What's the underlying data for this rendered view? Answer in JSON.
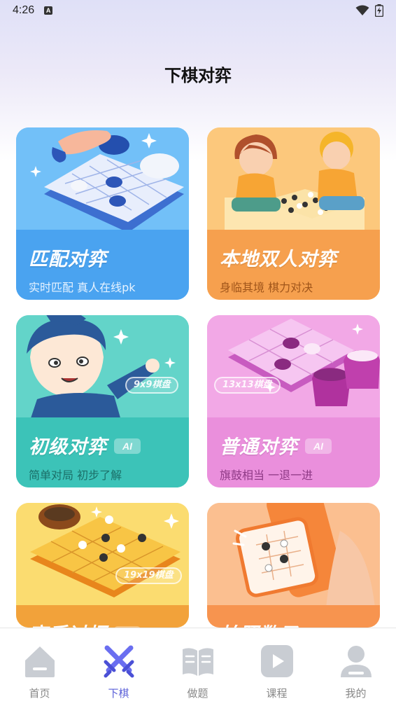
{
  "status_bar": {
    "time": "4:26",
    "notification_icon": "A"
  },
  "page_title": "下棋对弈",
  "cards": [
    {
      "title": "匹配对弈",
      "subtitle": "实时匹配 真人在线pk",
      "ai": "",
      "board": ""
    },
    {
      "title": "本地双人对弈",
      "subtitle": "身临其境 棋力对决",
      "ai": "",
      "board": ""
    },
    {
      "title": "初级对弈",
      "subtitle": "简单对局 初步了解",
      "ai": "AI",
      "board": "9x9棋盘"
    },
    {
      "title": "普通对弈",
      "subtitle": "旗鼓相当 一退一进",
      "ai": "AI",
      "board": "13x13棋盘"
    },
    {
      "title": "高手过招",
      "subtitle": "",
      "ai": "AI",
      "board": "19x19棋盘"
    },
    {
      "title": "拍照数子",
      "subtitle": "",
      "ai": "",
      "board": ""
    }
  ],
  "colors": {
    "accent": "#5a5fd8",
    "card1": "#4aa3f0",
    "card2": "#f6a04e",
    "card3": "#3cc3b8",
    "card4": "#ea8fdc",
    "card5": "#f2a23a",
    "card6": "#f7944f"
  },
  "tabs": [
    {
      "label": "首页",
      "icon": "home-icon",
      "active": false
    },
    {
      "label": "下棋",
      "icon": "crossed-swords-icon",
      "active": true
    },
    {
      "label": "做题",
      "icon": "book-icon",
      "active": false
    },
    {
      "label": "课程",
      "icon": "play-icon",
      "active": false
    },
    {
      "label": "我的",
      "icon": "user-icon",
      "active": false
    }
  ]
}
